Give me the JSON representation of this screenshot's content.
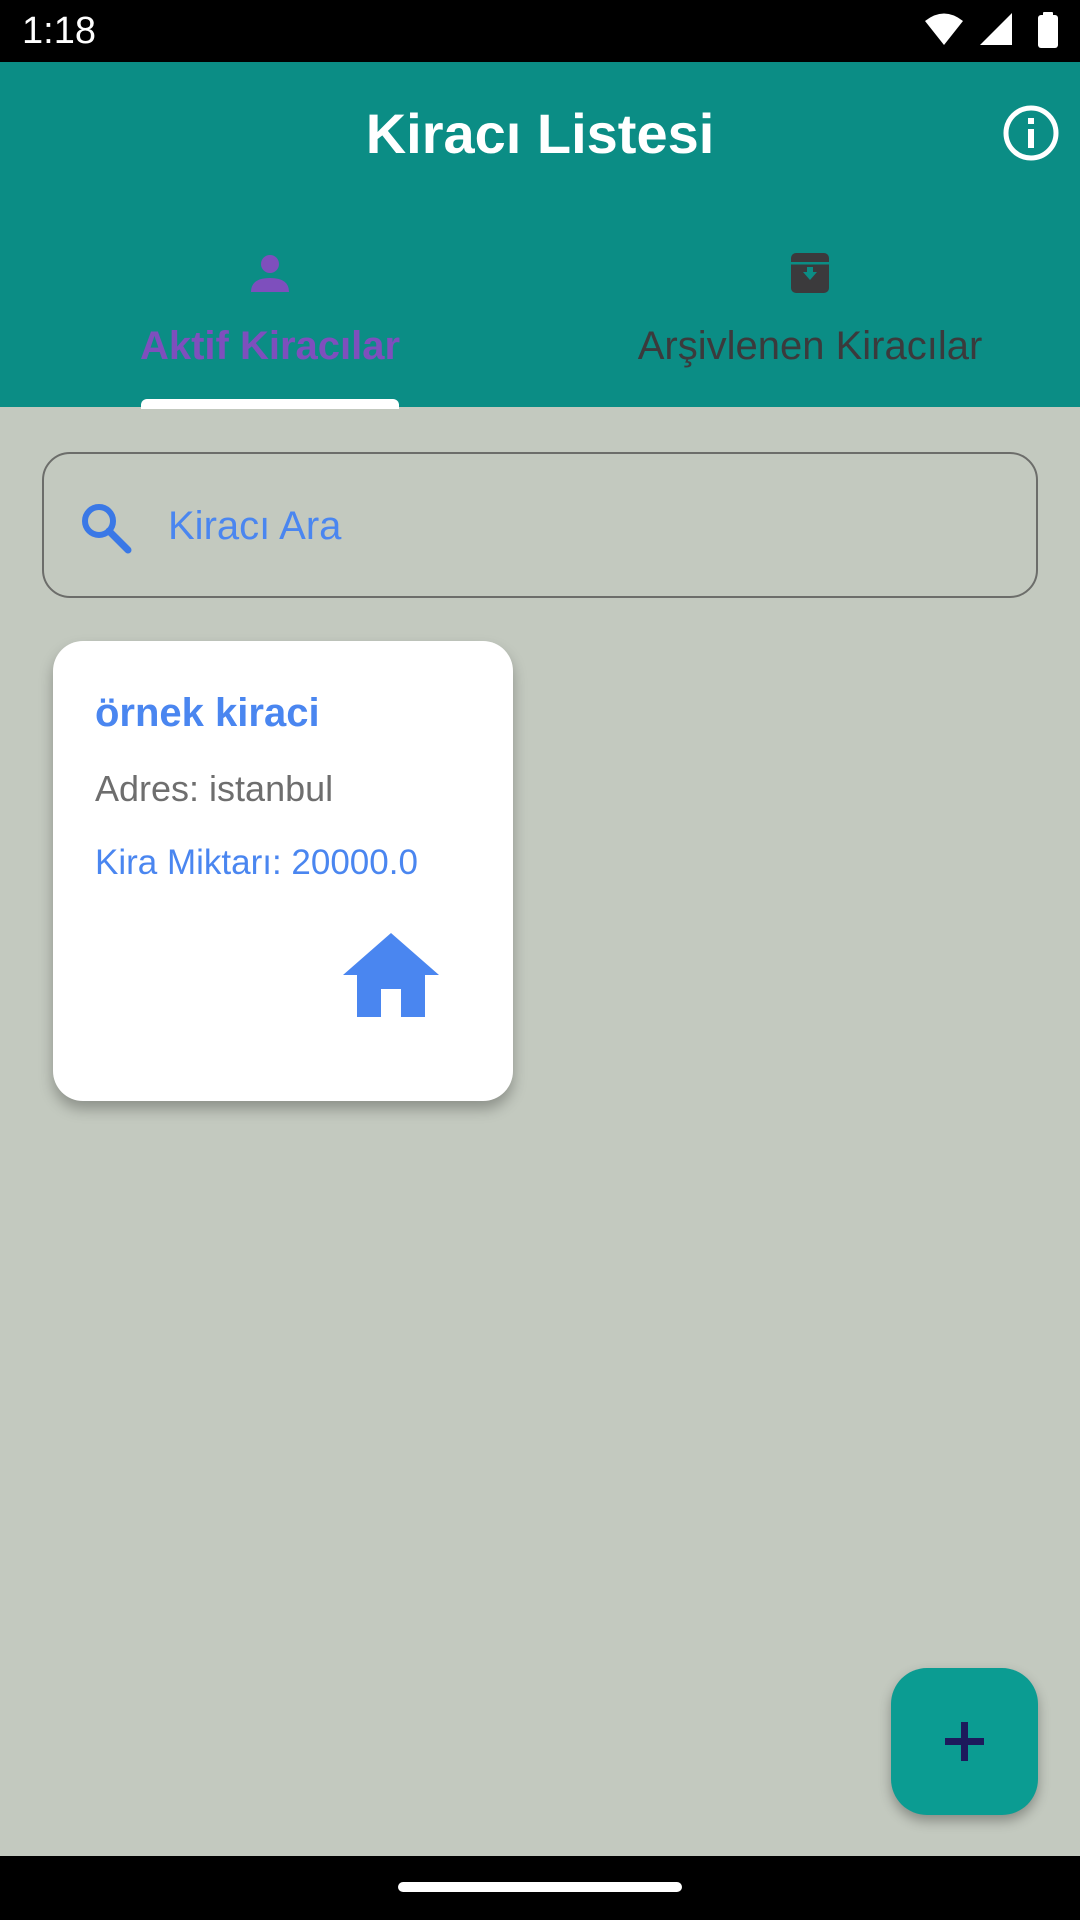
{
  "status_bar": {
    "time": "1:18"
  },
  "app_bar": {
    "title": "Kiracı Listesi"
  },
  "tabs": [
    {
      "label": "Aktif Kiracılar",
      "icon": "person-icon",
      "selected": true
    },
    {
      "label": "Arşivlenen Kiracılar",
      "icon": "archive-icon",
      "selected": false
    }
  ],
  "search": {
    "placeholder": "Kiracı Ara",
    "value": ""
  },
  "tenants": [
    {
      "name": "örnek kiraci",
      "address": "Adres: istanbul",
      "rent": "Kira Miktarı: 20000.0",
      "icon": "home-icon"
    }
  ],
  "fab": {
    "icon": "add-icon"
  },
  "colors": {
    "app_bar": "#0b8d85",
    "background": "#c3c9bf",
    "accent_blue": "#4a86f0",
    "tab_active": "#7e4fbd",
    "fab": "#0b9c92"
  }
}
